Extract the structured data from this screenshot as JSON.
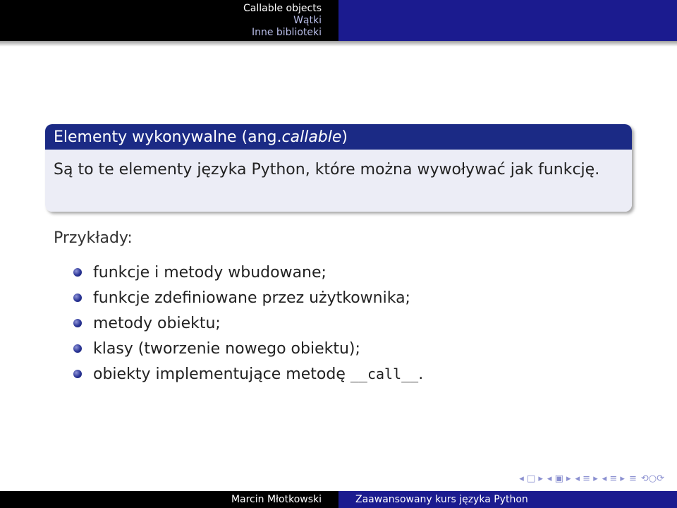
{
  "header": {
    "sections": [
      "Callable objects",
      "Wątki",
      "Inne biblioteki"
    ]
  },
  "block": {
    "title_prefix": "Elementy wykonywalne (ang.",
    "title_italic": "callable",
    "title_suffix": ")",
    "body": "Są to te elementy języka Python, które można wywoływać jak funkcję."
  },
  "examples_label": "Przykłady:",
  "items": [
    "funkcje i metody wbudowane;",
    "funkcje zdefiniowane przez użytkownika;",
    "metody obiektu;",
    "klasy (tworzenie nowego obiektu);"
  ],
  "last_item": {
    "prefix": "obiekty implementujące metodę ",
    "code": "__call__",
    "suffix": "."
  },
  "nav_icons": [
    "first-icon",
    "prev-frame-icon",
    "prev-subsection-icon",
    "prev-section-icon",
    "next-section-icon",
    "align-icon",
    "search-icon"
  ],
  "footer": {
    "author": "Marcin Młotkowski",
    "title": "Zaawansowany kurs języka Python"
  },
  "colors": {
    "header_bg": "#000000",
    "header_right_bg": "#1b1b8f",
    "block_title_bg": "#1b2a85",
    "block_body_bg": "#ecedf6"
  }
}
